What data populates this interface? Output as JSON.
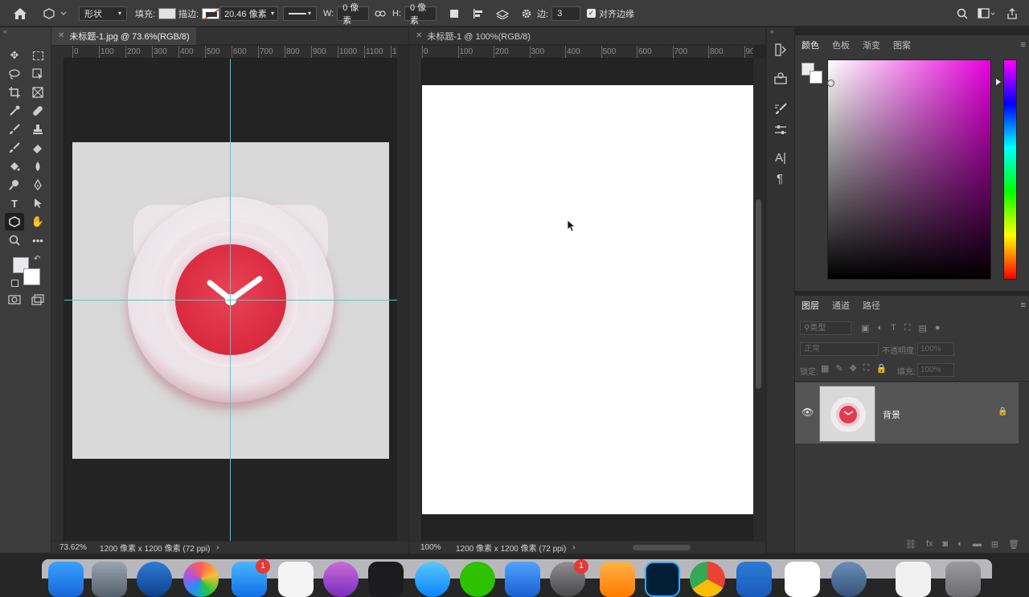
{
  "options_bar": {
    "mode": "形状",
    "fill_label": "填充:",
    "stroke_label": "描边:",
    "stroke_width": "20.46 像素",
    "w_label": "W:",
    "w_value": "0 像素",
    "h_label": "H:",
    "h_value": "0 像素",
    "sides_label": "边:",
    "sides_value": "3",
    "align_edges": "对齐边缘"
  },
  "doc1": {
    "tab": "未标题-1.jpg @ 73.6%(RGB/8)",
    "zoom": "73.62%",
    "size": "1200 像素 x 1200 像素 (72 ppi)",
    "ruler": [
      "0",
      "100",
      "200",
      "300",
      "400",
      "500",
      "600",
      "700",
      "800",
      "900",
      "1000",
      "1100",
      "12"
    ]
  },
  "doc2": {
    "tab": "未标题-1 @ 100%(RGB/8)",
    "zoom": "100%",
    "size": "1200 像素 x 1200 像素 (72 ppi)",
    "ruler": [
      "0",
      "100",
      "200",
      "300",
      "400",
      "500",
      "600",
      "700",
      "800",
      "90"
    ]
  },
  "color_panel": {
    "tabs": [
      "颜色",
      "色板",
      "渐变",
      "图案"
    ]
  },
  "layers_panel": {
    "tabs": [
      "图层",
      "通道",
      "路径"
    ],
    "search_placeholder": "类型",
    "blend_mode": "正常",
    "opacity_label": "不透明度:",
    "opacity_value": "100%",
    "lock_label": "锁定:",
    "fill_label": "填充:",
    "fill_value": "100%",
    "layer_name": "背景"
  },
  "dock": {
    "badges": [
      "1",
      "1"
    ]
  },
  "colors": {
    "accent_red": "#e33a4e",
    "guide": "#34d6d6",
    "canvas_bg": "#d9d9d9"
  }
}
